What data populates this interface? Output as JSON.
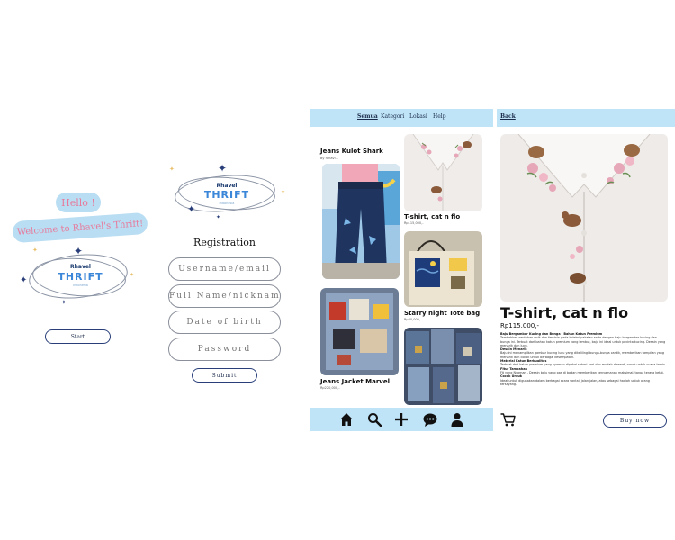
{
  "welcome": {
    "hello": "Hello !",
    "banner": "Welcome to Rhavel's Thrift!",
    "logo_top": "Rhavel",
    "logo_main": "THRIFT",
    "logo_sub": "Indonesia",
    "start_label": "Start"
  },
  "registration": {
    "logo_top": "Rhavel",
    "logo_main": "THRIFT",
    "logo_sub": "Indonesia",
    "title": "Registration",
    "fields": [
      {
        "placeholder": "Username/email"
      },
      {
        "placeholder": "Full Name/nickname"
      },
      {
        "placeholder": "Date of birth"
      },
      {
        "placeholder": "Password"
      }
    ],
    "submit_label": "Submit"
  },
  "catalog": {
    "nav": [
      "Semua",
      "Kategori",
      "Lokasi",
      "Help"
    ],
    "active_nav": "Semua",
    "products": [
      {
        "title": "Jeans Kulot Shark",
        "sub": "By rahavi..."
      },
      {
        "title": "T-shirt, cat n flo",
        "sub": "Rp115,000,-"
      },
      {
        "title": "Starry night Tote bag",
        "sub": "Rp80,000,-"
      },
      {
        "title": "Jeans Jacket Marvel",
        "sub": "Rp220,000,-"
      }
    ],
    "bottom_icons": [
      "home-icon",
      "search-icon",
      "add-icon",
      "chat-icon",
      "profile-icon"
    ]
  },
  "detail": {
    "back_label": "Back",
    "title": "T-shirt, cat n flo",
    "price": "Rp115.000,-",
    "desc": [
      {
        "head": "Baju Bergambar Kucing dan Bunga - Bahan Katun Premium",
        "body": "Tambahkan sentuhan unik dan feminin pada koleksi pakaian anda dengan baju bergambar kucing dan bunga ini. Terbuat dari bahan katun premium yang lembut, baju ini ideal untuk pecinta kucing. Desain yang menarik dan lucu."
      },
      {
        "head": "Desain Menarik",
        "body": "Baju ini menampilkan gambar kucing lucu yang dikelilingi bunga-bunga cantik, memberikan tampilan yang menarik dan cocok untuk berbagai kesempatan."
      },
      {
        "head": "Material Katun Berkualitas",
        "body": "Terbuat dari katun premium yang nyaman dipakai sehari-hari dan mudah dirawat, cocok untuk cuaca tropis."
      },
      {
        "head": "Fitur Tambahan",
        "body": "Fit yang Nyaman - Desain baju yang pas di badan memberikan kenyamanan maksimal, tanpa terasa ketat."
      },
      {
        "head": "Cocok Untuk",
        "body": "Ideal untuk digunakan dalam berbagai acara santai, jalan-jalan, atau sebagai hadiah untuk orang tersayang."
      }
    ],
    "buy_label": "Buy now"
  },
  "colors": {
    "nav_bg": "#bfe4f7",
    "accent_pink": "#e77a9c",
    "navy": "#2a3f7a"
  }
}
